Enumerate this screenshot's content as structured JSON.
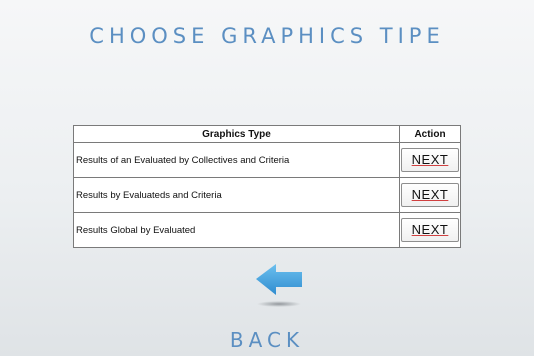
{
  "page": {
    "title": "CHOOSE GRAPHICS TIPE"
  },
  "table": {
    "headers": {
      "type": "Graphics Type",
      "action": "Action"
    },
    "rows": [
      {
        "type": "Results of an Evaluated by Collectives and Criteria",
        "action": "NEXT"
      },
      {
        "type": "Results by Evaluateds and Criteria",
        "action": "NEXT"
      },
      {
        "type": "Results Global by Evaluated",
        "action": "NEXT"
      }
    ]
  },
  "nav": {
    "back_label": "BACK",
    "back_icon": "left-arrow-icon"
  },
  "colors": {
    "title": "#5b8fc2",
    "arrow": "#3f9bd6"
  }
}
